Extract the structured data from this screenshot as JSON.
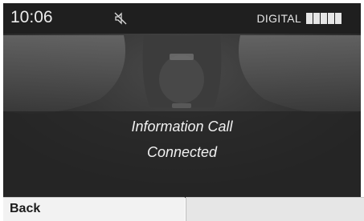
{
  "status_bar": {
    "time": "10:06",
    "signal_label": "DIGITAL",
    "signal_bars": 5,
    "mute_icon": "speaker-muted-icon"
  },
  "message": {
    "line1": "Information Call",
    "line2": "Connected"
  },
  "softkeys": {
    "back_label": "Back"
  },
  "colors": {
    "screen_bg": "#2c2c2c",
    "text": "#f1f1f1"
  }
}
